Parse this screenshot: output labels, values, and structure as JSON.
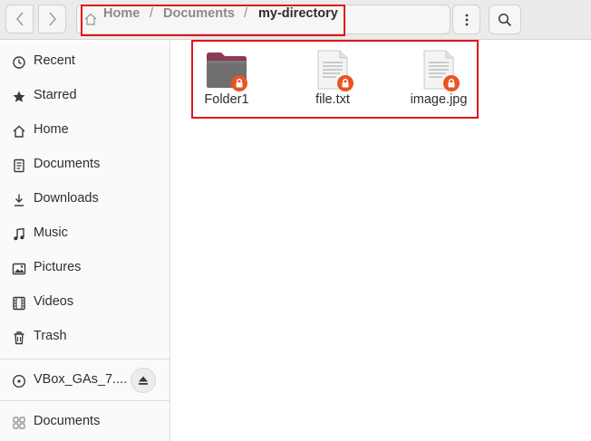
{
  "header": {
    "breadcrumbs": [
      "Home",
      "Documents",
      "my-directory"
    ],
    "separator": "/",
    "icons": {
      "back": "chevron-left-icon",
      "forward": "chevron-right-icon",
      "home": "home-icon",
      "menu": "kebab-menu-icon",
      "search": "search-icon"
    }
  },
  "sidebar": {
    "items": [
      {
        "label": "Recent",
        "icon": "clock-icon"
      },
      {
        "label": "Starred",
        "icon": "star-icon"
      },
      {
        "label": "Home",
        "icon": "home-icon"
      },
      {
        "label": "Documents",
        "icon": "document-icon"
      },
      {
        "label": "Downloads",
        "icon": "download-icon"
      },
      {
        "label": "Music",
        "icon": "music-note-icon"
      },
      {
        "label": "Pictures",
        "icon": "picture-icon"
      },
      {
        "label": "Videos",
        "icon": "film-icon"
      },
      {
        "label": "Trash",
        "icon": "trash-icon"
      }
    ],
    "devices": [
      {
        "label": "VBox_GAs_7....",
        "icon": "disc-icon",
        "eject_icon": "eject-icon"
      }
    ],
    "bookmarks": [
      {
        "label": "Documents",
        "icon": "folder-bookmark-icon"
      }
    ]
  },
  "files": [
    {
      "name": "Folder1",
      "kind": "folder",
      "badge": "lock-icon"
    },
    {
      "name": "file.txt",
      "kind": "text-file",
      "badge": "lock-icon"
    },
    {
      "name": "image.jpg",
      "kind": "text-file",
      "badge": "lock-icon"
    }
  ],
  "colors": {
    "highlight": "#e0141c",
    "lock_badge": "#e95420",
    "folder_tab": "#8c3a59",
    "folder_body": "#6f6f6f"
  }
}
